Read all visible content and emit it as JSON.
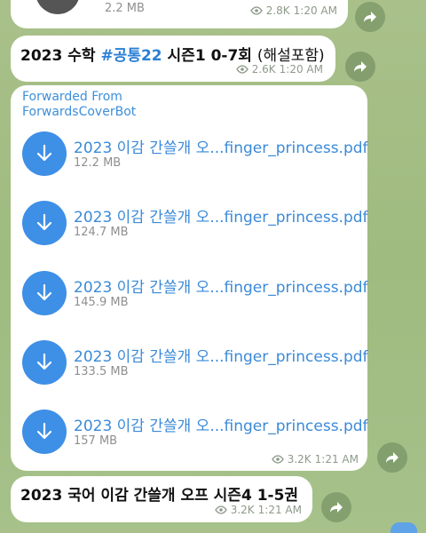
{
  "top_message": {
    "file_size": "2.2 MB",
    "views": "2.8K",
    "time": "1:20 AM"
  },
  "message2": {
    "title_prefix": "2023 수학 ",
    "hashtag": "#공통22",
    "title_mid": " 시즌1 0-7회 ",
    "title_rest": "(해설포함)",
    "views": "2.6K",
    "time": "1:20 AM"
  },
  "message3": {
    "forwarded_line1": "Forwarded From",
    "forwarded_line2": "ForwardsCoverBot",
    "files": [
      {
        "name": "2023 이감 간쓸개 오...finger_princess.pdf",
        "size": "12.2 MB"
      },
      {
        "name": "2023 이감 간쓸개 오...finger_princess.pdf",
        "size": "124.7 MB"
      },
      {
        "name": "2023 이감 간쓸개 오...finger_princess.pdf",
        "size": "145.9 MB"
      },
      {
        "name": "2023 이감 간쓸개 오...finger_princess.pdf",
        "size": "133.5 MB"
      },
      {
        "name": "2023 이감 간쓸개 오...finger_princess.pdf",
        "size": "157 MB"
      }
    ],
    "views": "3.2K",
    "time": "1:21 AM"
  },
  "message4": {
    "title": "2023 국어 이감 간쓸개 오프 시즌4 1-5권",
    "views": "3.2K",
    "time": "1:21 AM"
  },
  "icons": {
    "eye": "eye-icon",
    "share": "share-arrow-icon",
    "download": "download-arrow-icon"
  },
  "colors": {
    "accent_blue": "#3e8fe6",
    "link_blue": "#3b8ad8",
    "background_green": "#a9c08a"
  }
}
